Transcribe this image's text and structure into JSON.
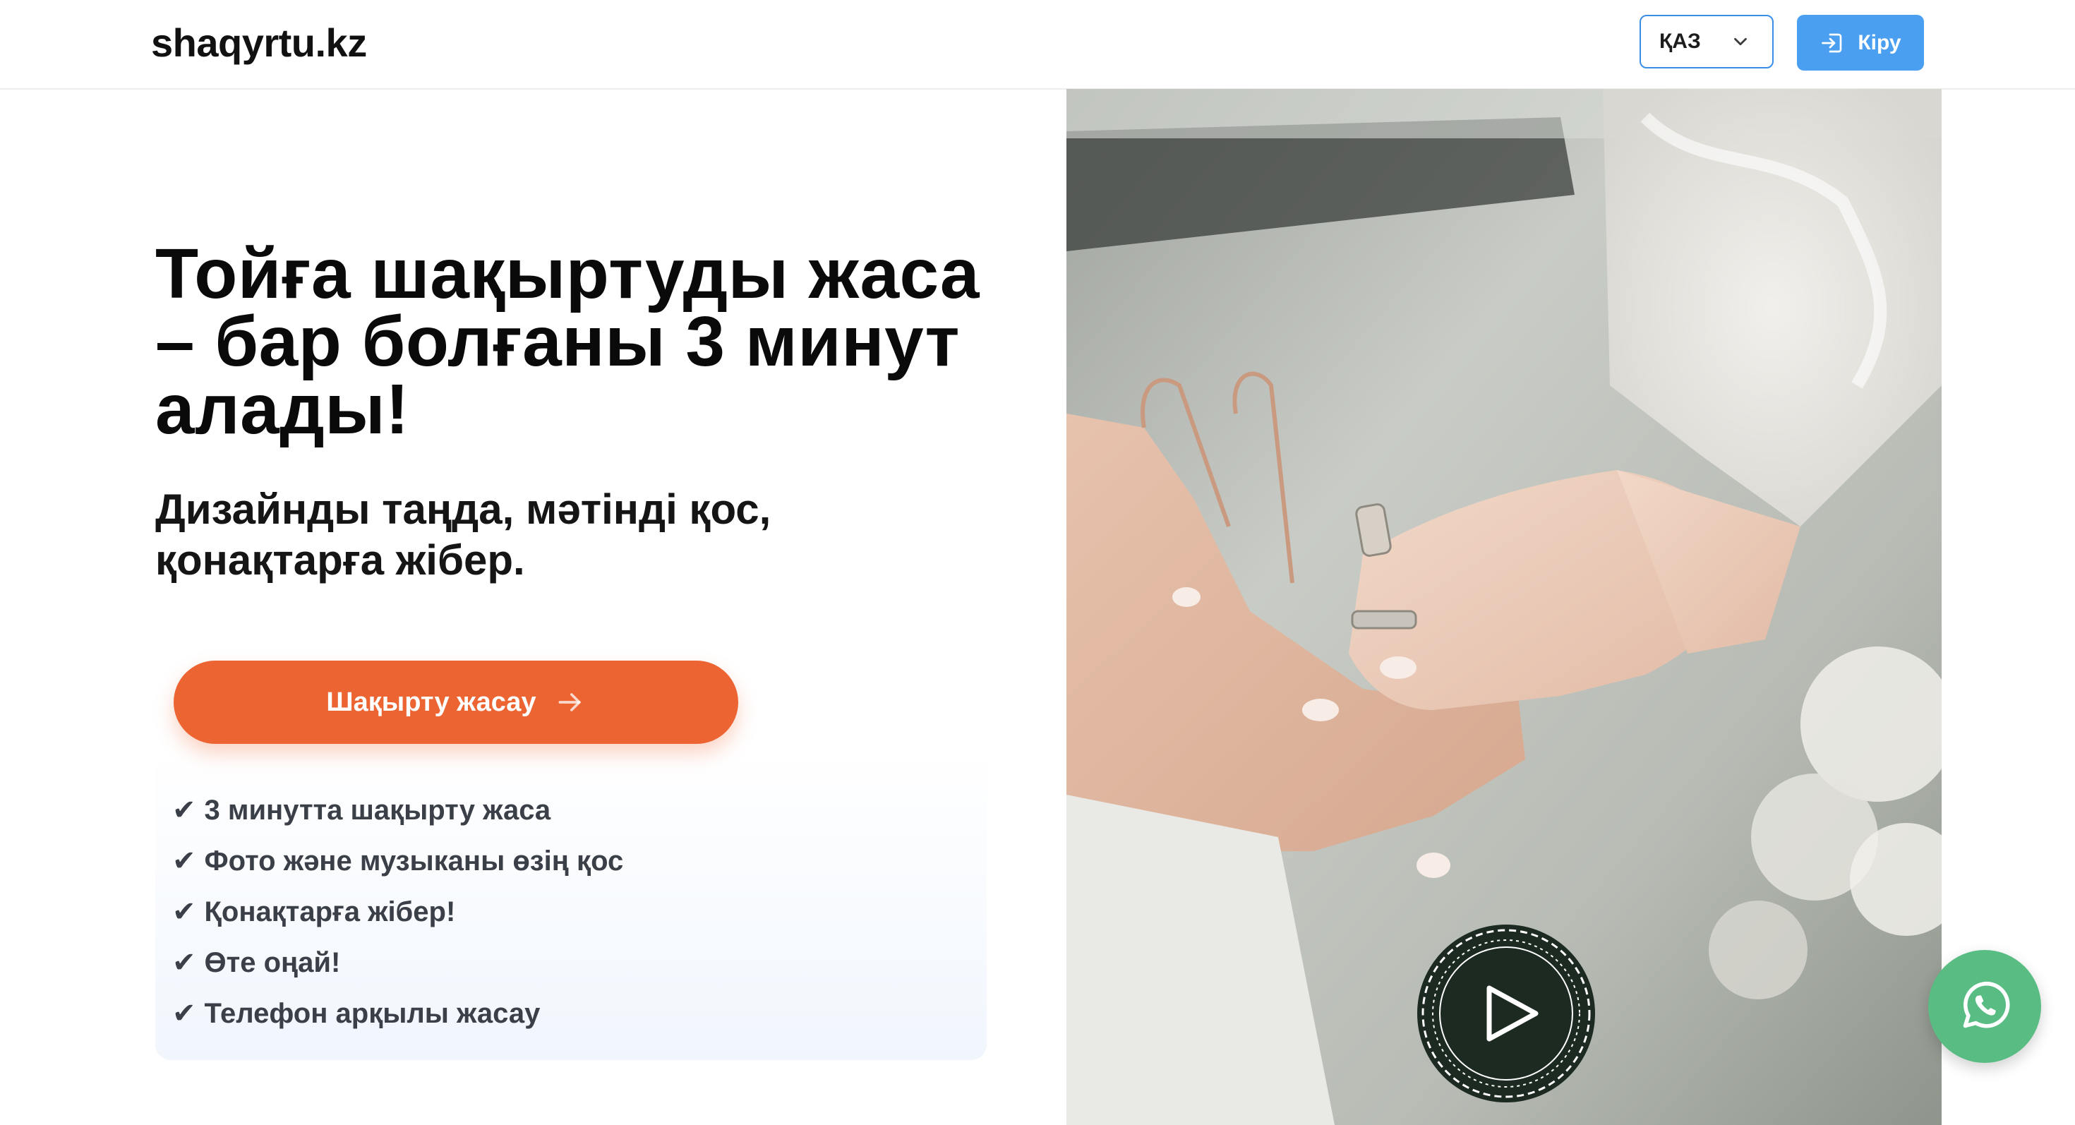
{
  "header": {
    "logo": "shaqyrtu.kz",
    "language": {
      "selected": "ҚАЗ",
      "icon": "chevron-down-icon"
    },
    "login": {
      "label": "Кіру",
      "icon": "login-icon"
    }
  },
  "hero": {
    "title": "Тойға шақыртуды жаса – бар болғаны 3 минут алады!",
    "subtitle": "Дизайнды таңда, мәтінді қос, қонақтарға жібер.",
    "cta": {
      "label": "Шақырту жасау",
      "icon": "arrow-right-icon"
    },
    "features": [
      "3 минутта шақырту жаса",
      "Фото және музыканы өзің қос",
      "Қонақтарға жібер!",
      "Өте оңай!",
      "Телефон арқылы жасау"
    ],
    "check_mark": "✔"
  },
  "media": {
    "image_icon": "wedding-rings-photo",
    "play_icon": "play-icon"
  },
  "floating": {
    "whatsapp_icon": "whatsapp-icon"
  },
  "colors": {
    "accent_orange": "#ec6432",
    "login_blue": "#4a9ff0",
    "select_border": "#3a8ee6",
    "whatsapp_green": "#59bd83",
    "play_dark": "#1c2a22"
  }
}
